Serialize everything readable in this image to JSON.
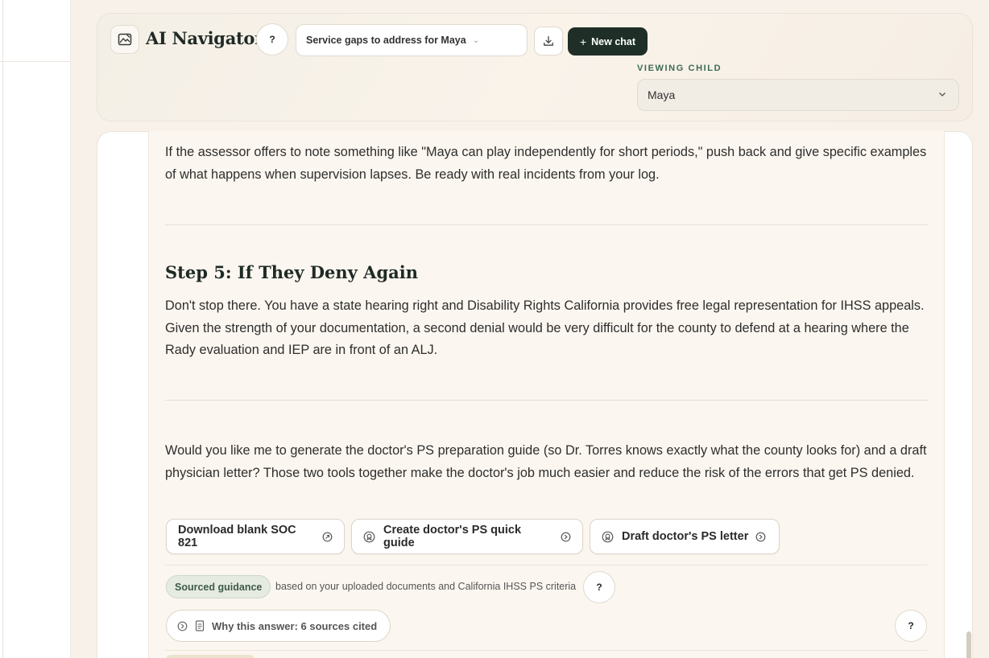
{
  "app": {
    "title": "AI Navigator",
    "help_glyph": "?",
    "logo_icon": "map-icon"
  },
  "header": {
    "conversation_select": "Service gaps to address for Maya",
    "download_icon": "download-icon",
    "new_chat_label": "New chat",
    "viewing_child_label": "VIEWING CHILD",
    "child_select_value": "Maya"
  },
  "content": {
    "para_assessor": "If the assessor offers to note something like \"Maya can play independently for short periods,\" push back and give specific examples of what happens when supervision lapses. Be ready with real incidents from your log.",
    "step5_heading": "Step 5: If They Deny Again",
    "step5_body": "Don't stop there. You have a state hearing right and Disability Rights California provides free legal representation for IHSS appeals. Given the strength of your documentation, a second denial would be very difficult for the county to defend at a hearing where the Rady evaluation and IEP are in front of an ALJ.",
    "followup": "Would you like me to generate the doctor's PS preparation guide (so Dr. Torres knows exactly what the county looks for) and a draft physician letter? Those two tools together make the doctor's job much easier and reduce the risk of the errors that get PS denied.",
    "actions": [
      {
        "label": "Download blank SOC 821",
        "icon": "external-link-icon"
      },
      {
        "label": "Create doctor's PS quick guide",
        "icon": "sparkle-icon"
      },
      {
        "label": "Draft doctor's PS letter",
        "icon": "sparkle-icon"
      }
    ],
    "sourced_badge": "Sourced guidance",
    "sourced_text": "based on your uploaded documents and California IHSS PS criteria",
    "why_answer": "Why this answer: 6 sources cited"
  },
  "colors": {
    "accent_dark": "#1f2f28",
    "accent_green": "#3c6b55",
    "page_background": "#fbf6ef"
  }
}
